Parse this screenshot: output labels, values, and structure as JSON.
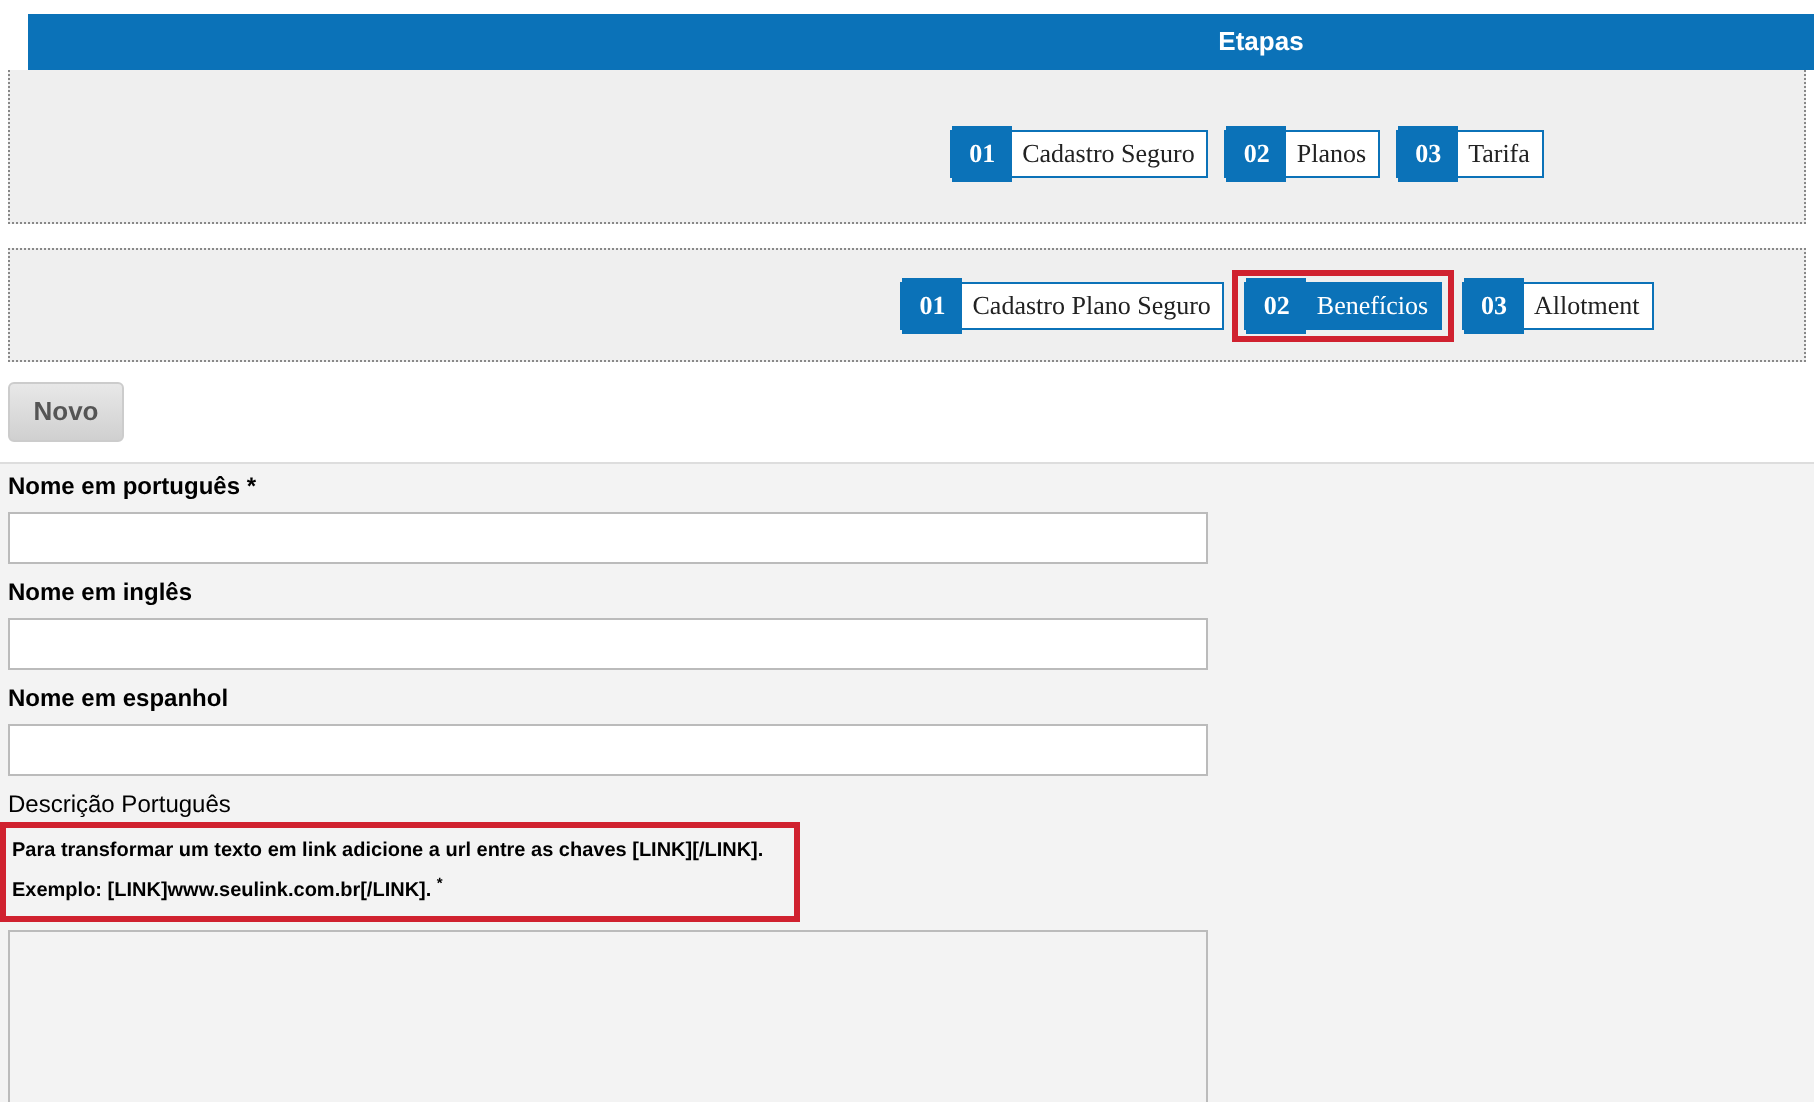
{
  "header": {
    "title": "Etapas"
  },
  "stage_groups": [
    {
      "steps": [
        {
          "number": "01",
          "label": "Cadastro Seguro",
          "selected": false,
          "highlighted": false
        },
        {
          "number": "02",
          "label": "Planos",
          "selected": false,
          "highlighted": false
        },
        {
          "number": "03",
          "label": "Tarifa",
          "selected": false,
          "highlighted": false
        }
      ]
    },
    {
      "steps": [
        {
          "number": "01",
          "label": "Cadastro Plano Seguro",
          "selected": false,
          "highlighted": false
        },
        {
          "number": "02",
          "label": "Benefícios",
          "selected": true,
          "highlighted": true
        },
        {
          "number": "03",
          "label": "Allotment",
          "selected": false,
          "highlighted": false
        }
      ]
    }
  ],
  "new_button": "Novo",
  "fields": [
    {
      "kind": "input",
      "label": "Nome em português *"
    },
    {
      "kind": "input",
      "label": "Nome em inglês"
    },
    {
      "kind": "input",
      "label": "Nome em espanhol"
    },
    {
      "kind": "textarea",
      "label": "Descrição Português",
      "hint_highlighted": true,
      "hint": [
        "Para transformar um texto em link adicione a url entre as chaves [LINK][/LINK].",
        "Exemplo: [LINK]www.seulink.com.br[/LINK]. $^{*}$"
      ]
    }
  ]
}
